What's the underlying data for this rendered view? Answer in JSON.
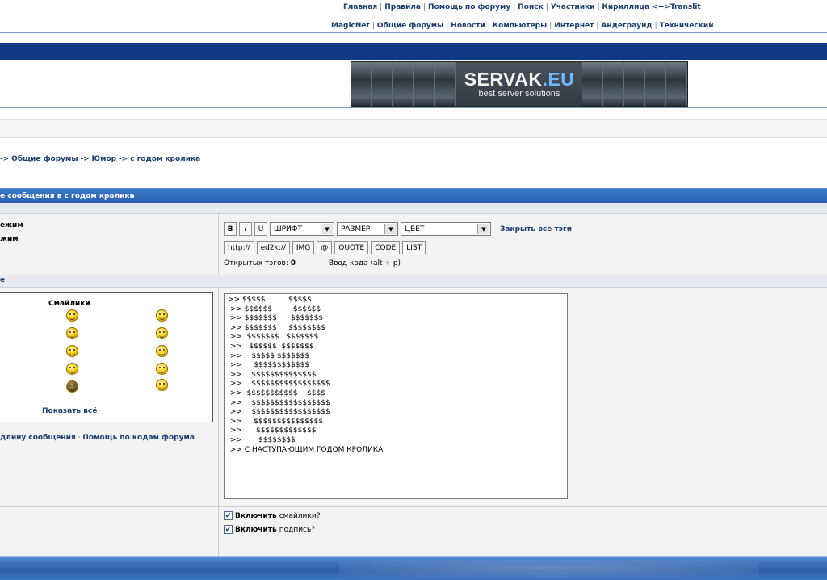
{
  "nav_primary": [
    "Главная",
    "Правила",
    "Помощь по форуму",
    "Поиск",
    "Участники",
    "Кириллица <-->Translit"
  ],
  "nav_secondary": [
    "MagicNet",
    "Общие форумы",
    "Новости",
    "Компьютеры",
    "Интернет",
    "Андеграунд",
    "Технический"
  ],
  "banner": {
    "brand": "SERVAK",
    "brand_suffix": ".EU",
    "tagline": "best server solutions"
  },
  "breadcrumb": {
    "lead": " ->",
    "items": [
      "Общие форумы",
      "Юмор",
      "с годом кролика"
    ]
  },
  "title_bar": "е сообщения в с годом кролика",
  "left_modes": [
    "ежим",
    "жим"
  ],
  "divider_label": "е",
  "toolbar": {
    "bold": "B",
    "italic": "I",
    "underline": "U",
    "font_select": "ШРИФТ",
    "size_select": "РАЗМЕР",
    "color_select": "ЦВЕТ",
    "close_tags": "Закрыть все тэги",
    "tags": [
      "http://",
      "ed2k://",
      "IMG",
      "@",
      "QUOTE",
      "CODE",
      "LIST"
    ],
    "open_tags_label": "Открытых тэгов:",
    "open_tags_count": "0",
    "hint": "Ввод кода (alt + p)"
  },
  "smilies": {
    "title": "Смайлики",
    "show_all": "Показать всё"
  },
  "help_links": [
    "длину сообщения",
    "Помощь по кодам форума"
  ],
  "help_separator": "·",
  "message": ">> $$$$$          $$$$$\n >> $$$$$$         $$$$$$\n >> $$$$$$$      $$$$$$$\n >> $$$$$$$     $$$$$$$$\n >>  $$$$$$$   $$$$$$$\n >>   $$$$$$  $$$$$$$\n >>    $$$$$ $$$$$$$\n >>     $$$$$$$$$$$$\n >>    $$$$$$$$$$$$$$\n >>    $$$$$$$$$$$$$$$$$\n >>  $$$$$$$$$$$    $$$$\n >>    $$$$$$$$$$$$$$$$$\n >>    $$$$$$$$$$$$$$$$$\n >>     $$$$$$$$$$$$$$$\n >>      $$$$$$$$$$$$$\n >>       $$$$$$$$\n >> С НАСТУПАЮЩИМ ГОДОМ КРОЛИКА",
  "options": [
    {
      "bold": "Включить",
      "rest": " смайлики?",
      "checked": true
    },
    {
      "bold": "Включить",
      "rest": " подпись?",
      "checked": true
    }
  ],
  "checkbox_mark": "✔",
  "select_arrow": "▼"
}
